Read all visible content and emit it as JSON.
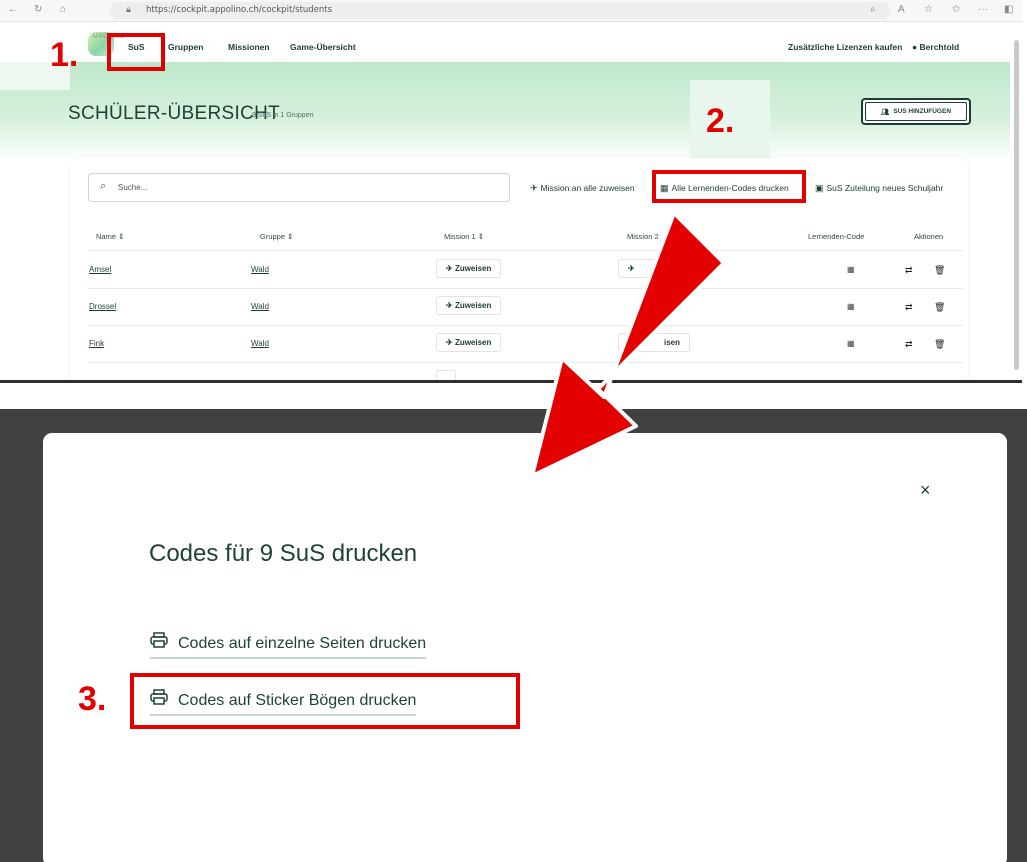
{
  "browser": {
    "url": "https://cockpit.appolino.ch/cockpit/students",
    "url_domain": "cockpit.appolino.ch",
    "url_path": "/cockpit/students"
  },
  "nav": {
    "logo_text": "APPO LINO",
    "items": [
      "SuS",
      "Gruppen",
      "Missionen",
      "Game-Übersicht"
    ],
    "buy_licenses": "Zusätzliche Lizenzen kaufen",
    "user": "Berchtold"
  },
  "page": {
    "title": "SCHÜLER-ÜBERSICHT",
    "subtitle": "9 SuS in 1 Gruppen",
    "add_button": "SUS HINZUFÜGEN"
  },
  "toolbar": {
    "search_placeholder": "Suche...",
    "assign_all": "Mission an alle zuweisen",
    "print_codes": "Alle Lernenden-Codes drucken",
    "new_year": "SuS Zuteilung neues Schuljahr"
  },
  "table": {
    "headers": [
      "Name",
      "Gruppe",
      "Mission 1",
      "Mission 2",
      "Lernenden-Code",
      "Aktionen"
    ],
    "rows": [
      {
        "name": "Amsel",
        "group": "Wald",
        "m1": "Zuweisen",
        "m2": ""
      },
      {
        "name": "Drossel",
        "group": "Wald",
        "m1": "Zuweisen",
        "m2": ""
      },
      {
        "name": "Fink",
        "group": "Wald",
        "m1": "Zuweisen",
        "m2": "isen"
      }
    ]
  },
  "modal": {
    "title": "Codes für 9 SuS drucken",
    "option1": "Codes auf einzelne Seiten drucken",
    "option2": "Codes auf Sticker Bögen drucken",
    "close": "×"
  },
  "annotations": {
    "step1": "1.",
    "step2": "2.",
    "step3": "3.",
    "color": "#e30000"
  }
}
